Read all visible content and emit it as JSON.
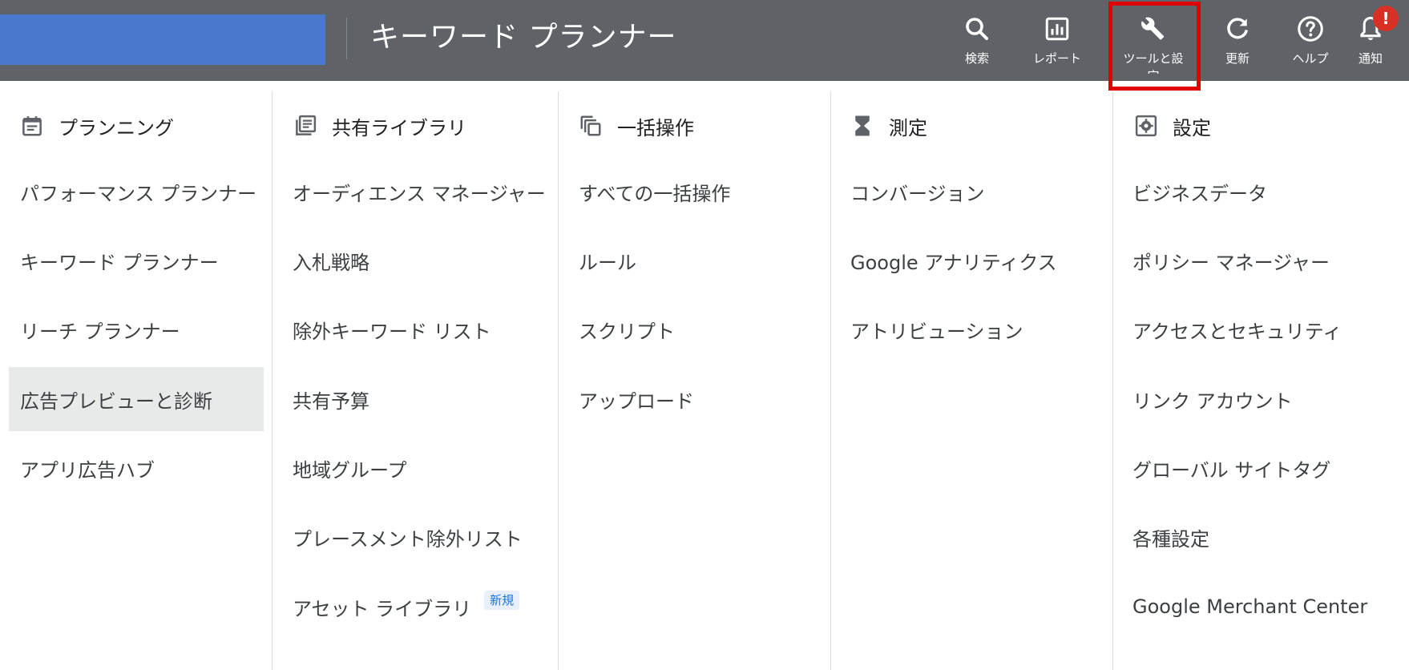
{
  "header": {
    "title": "キーワード プランナー",
    "buttons": [
      {
        "label": "検索",
        "icon": "search-icon"
      },
      {
        "label": "レポート",
        "icon": "report-icon"
      },
      {
        "label": "ツールと設定",
        "icon": "wrench-icon"
      },
      {
        "label": "更新",
        "icon": "refresh-icon"
      },
      {
        "label": "ヘルプ",
        "icon": "help-icon"
      },
      {
        "label": "通知",
        "icon": "bell-icon"
      }
    ],
    "notification_badge": "!"
  },
  "columns": [
    {
      "title": "プランニング",
      "icon": "calendar-icon",
      "items": [
        "パフォーマンス プランナー",
        "キーワード プランナー",
        "リーチ プランナー",
        "広告プレビューと診断",
        "アプリ広告ハブ"
      ],
      "active_item": "広告プレビューと診断"
    },
    {
      "title": "共有ライブラリ",
      "icon": "library-icon",
      "items": [
        "オーディエンス マネージャー",
        "入札戦略",
        "除外キーワード リスト",
        "共有予算",
        "地域グループ",
        "プレースメント除外リスト",
        "アセット ライブラリ"
      ],
      "new_badge": "新規"
    },
    {
      "title": "一括操作",
      "icon": "copy-icon",
      "items": [
        "すべての一括操作",
        "ルール",
        "スクリプト",
        "アップロード"
      ]
    },
    {
      "title": "測定",
      "icon": "hourglass-icon",
      "items": [
        "コンバージョン",
        "Google アナリティクス",
        "アトリビューション"
      ]
    },
    {
      "title": "設定",
      "icon": "settings-icon",
      "items": [
        "ビジネスデータ",
        "ポリシー マネージャー",
        "アクセスとセキュリティ",
        "リンク アカウント",
        "グローバル サイトタグ",
        "各種設定",
        "Google Merchant Center"
      ]
    }
  ],
  "colors": {
    "topbar": "#5f6368",
    "brand": "#4a78cc",
    "highlight": "#e00000",
    "badge": "#d93025"
  }
}
